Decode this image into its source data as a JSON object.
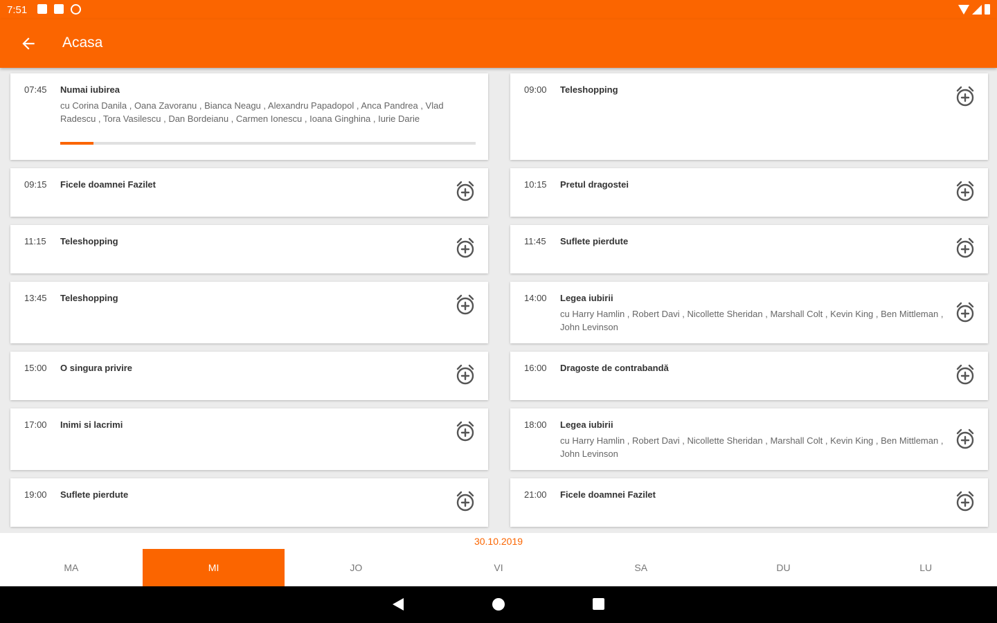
{
  "status_bar": {
    "time": "7:51",
    "left_icons": [
      "notification-icon",
      "sd-card-icon",
      "sync-icon"
    ],
    "right_icons": [
      "wifi-icon",
      "signal-icon",
      "battery-icon"
    ]
  },
  "app_bar": {
    "title": "Acasa",
    "back_icon": "arrow-back-icon"
  },
  "accent_color": "#fb6500",
  "schedule_left": [
    {
      "time": "07:45",
      "title": "Numai iubirea",
      "cast": "cu Corina Danila , Oana Zavoranu , Bianca Neagu , Alexandru Papadopol , Anca Pandrea , Vlad Radescu , Tora Vasilescu , Dan Bordeianu , Carmen Ionescu , Ioana Ginghina , Iurie Darie",
      "progress": 0.08,
      "alarm": false
    },
    {
      "time": "09:15",
      "title": "Ficele doamnei Fazilet",
      "cast": "",
      "alarm": true
    },
    {
      "time": "11:15",
      "title": "Teleshopping",
      "cast": "",
      "alarm": true
    },
    {
      "time": "13:45",
      "title": "Teleshopping",
      "cast": "",
      "alarm": true
    },
    {
      "time": "15:00",
      "title": "O singura privire",
      "cast": "",
      "alarm": true
    },
    {
      "time": "17:00",
      "title": "Inimi si lacrimi",
      "cast": "",
      "alarm": true
    },
    {
      "time": "19:00",
      "title": "Suflete pierdute",
      "cast": "",
      "alarm": true
    }
  ],
  "schedule_right": [
    {
      "time": "09:00",
      "title": "Teleshopping",
      "cast": "",
      "alarm": true
    },
    {
      "time": "10:15",
      "title": "Pretul dragostei",
      "cast": "",
      "alarm": true
    },
    {
      "time": "11:45",
      "title": "Suflete pierdute",
      "cast": "",
      "alarm": true
    },
    {
      "time": "14:00",
      "title": "Legea iubirii",
      "cast": "cu Harry Hamlin , Robert Davi , Nicollette Sheridan , Marshall Colt , Kevin King , Ben Mittleman , John Levinson",
      "alarm": true
    },
    {
      "time": "16:00",
      "title": "Dragoste de contrabandă",
      "cast": "",
      "alarm": true
    },
    {
      "time": "18:00",
      "title": "Legea iubirii",
      "cast": "cu Harry Hamlin , Robert Davi , Nicollette Sheridan , Marshall Colt , Kevin King , Ben Mittleman , John Levinson",
      "alarm": true
    },
    {
      "time": "21:00",
      "title": "Ficele doamnei Fazilet",
      "cast": "",
      "alarm": true
    }
  ],
  "date": "30.10.2019",
  "day_tabs": [
    {
      "label": "MA",
      "active": false
    },
    {
      "label": "MI",
      "active": true
    },
    {
      "label": "JO",
      "active": false
    },
    {
      "label": "VI",
      "active": false
    },
    {
      "label": "SA",
      "active": false
    },
    {
      "label": "DU",
      "active": false
    },
    {
      "label": "LU",
      "active": false
    }
  ],
  "nav_bar": {
    "buttons": [
      "back-triangle-icon",
      "home-circle-icon",
      "recents-square-icon"
    ]
  }
}
